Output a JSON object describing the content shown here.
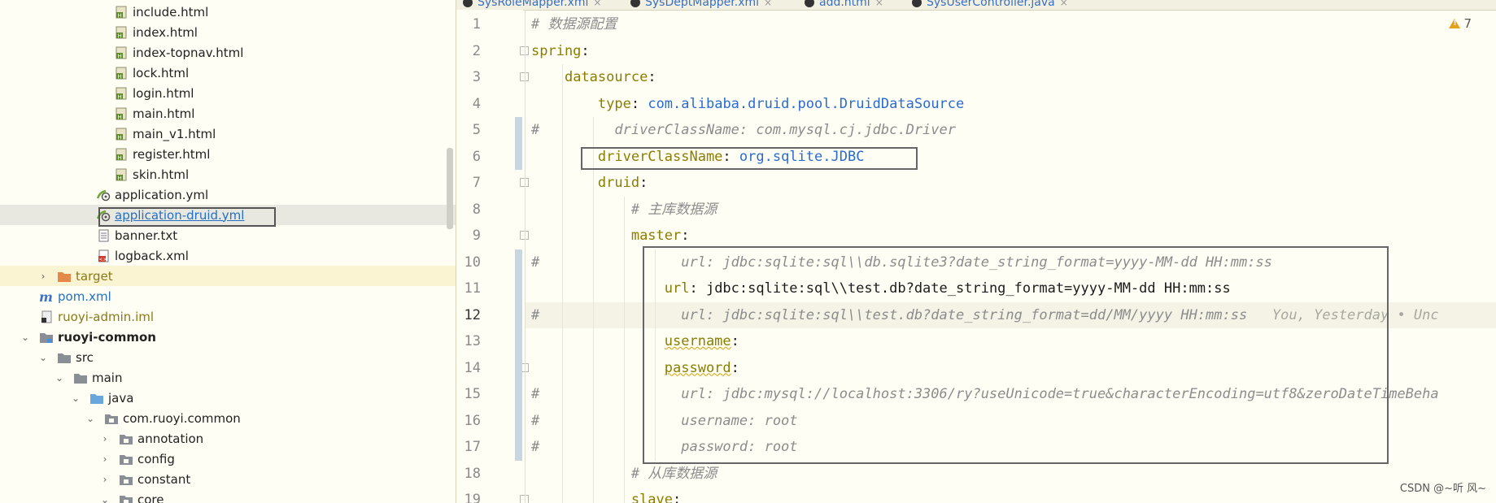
{
  "sidebar": {
    "items": [
      {
        "label": "include.html",
        "type": "html",
        "indent": 3
      },
      {
        "label": "index.html",
        "type": "html",
        "indent": 3
      },
      {
        "label": "index-topnav.html",
        "type": "html",
        "indent": 3
      },
      {
        "label": "lock.html",
        "type": "html",
        "indent": 3
      },
      {
        "label": "login.html",
        "type": "html",
        "indent": 3
      },
      {
        "label": "main.html",
        "type": "html",
        "indent": 3
      },
      {
        "label": "main_v1.html",
        "type": "html",
        "indent": 3
      },
      {
        "label": "register.html",
        "type": "html",
        "indent": 3
      },
      {
        "label": "skin.html",
        "type": "html",
        "indent": 3
      },
      {
        "label": "application.yml",
        "type": "yml",
        "indent": 2
      },
      {
        "label": "application-druid.yml",
        "type": "yml",
        "indent": 2,
        "selected": true
      },
      {
        "label": "banner.txt",
        "type": "txt",
        "indent": 2
      },
      {
        "label": "logback.xml",
        "type": "xml",
        "indent": 2
      },
      {
        "label": "target",
        "type": "folder-orange",
        "indent": 0,
        "arrow": "›",
        "excluded": true
      },
      {
        "label": "pom.xml",
        "type": "maven",
        "indent": 0
      },
      {
        "label": "ruoyi-admin.iml",
        "type": "iml",
        "indent": 0
      },
      {
        "label": "ruoyi-common",
        "type": "module",
        "indent": -1,
        "arrow": "⌄",
        "bold": true
      },
      {
        "label": "src",
        "type": "folder",
        "indent": 0,
        "arrow": "⌄"
      },
      {
        "label": "main",
        "type": "folder",
        "indent": 1,
        "arrow": "⌄"
      },
      {
        "label": "java",
        "type": "folder-blue",
        "indent": 2,
        "arrow": "⌄"
      },
      {
        "label": "com.ruoyi.common",
        "type": "package",
        "indent": 3,
        "arrow": "⌄"
      },
      {
        "label": "annotation",
        "type": "package",
        "indent": 4,
        "arrow": "›"
      },
      {
        "label": "config",
        "type": "package",
        "indent": 4,
        "arrow": "›"
      },
      {
        "label": "constant",
        "type": "package",
        "indent": 4,
        "arrow": "›"
      },
      {
        "label": "core",
        "type": "package",
        "indent": 4,
        "arrow": "⌄"
      }
    ]
  },
  "tabs": [
    {
      "label": "SysRoleMapper.xml"
    },
    {
      "label": "SysDeptMapper.xml"
    },
    {
      "label": "add.html"
    },
    {
      "label": "SysUserController.java"
    }
  ],
  "editor": {
    "warnings": "7",
    "current_line": 12,
    "lines": [
      {
        "n": "1",
        "tokens": [
          [
            "cmt",
            "# 数据源配置"
          ]
        ]
      },
      {
        "n": "2",
        "tokens": [
          [
            "key",
            "spring"
          ],
          [
            "txt",
            ":"
          ]
        ]
      },
      {
        "n": "3",
        "tokens": [
          [
            "txt",
            "    "
          ],
          [
            "key",
            "datasource"
          ],
          [
            "txt",
            ":"
          ]
        ]
      },
      {
        "n": "4",
        "tokens": [
          [
            "txt",
            "        "
          ],
          [
            "key",
            "type"
          ],
          [
            "txt",
            ": "
          ],
          [
            "val",
            "com.alibaba.druid.pool.DruidDataSource"
          ]
        ]
      },
      {
        "n": "5",
        "tokens": [
          [
            "hash",
            "#"
          ],
          [
            "cmt",
            "         driverClassName: com.mysql.cj.jdbc.Driver"
          ]
        ]
      },
      {
        "n": "6",
        "tokens": [
          [
            "txt",
            "        "
          ],
          [
            "key",
            "driverClassName"
          ],
          [
            "txt",
            ": "
          ],
          [
            "val",
            "org.sqlite.JDBC"
          ]
        ]
      },
      {
        "n": "7",
        "tokens": [
          [
            "txt",
            "        "
          ],
          [
            "key",
            "druid"
          ],
          [
            "txt",
            ":"
          ]
        ]
      },
      {
        "n": "8",
        "tokens": [
          [
            "txt",
            "            "
          ],
          [
            "cmt",
            "# 主库数据源"
          ]
        ]
      },
      {
        "n": "9",
        "tokens": [
          [
            "txt",
            "            "
          ],
          [
            "key",
            "master"
          ],
          [
            "txt",
            ":"
          ]
        ]
      },
      {
        "n": "10",
        "tokens": [
          [
            "hash",
            "#"
          ],
          [
            "cmt",
            "                 url: jdbc:sqlite:sql\\\\db.sqlite3?date_string_format=yyyy-MM-dd HH:mm:ss"
          ]
        ]
      },
      {
        "n": "11",
        "tokens": [
          [
            "txt",
            "                "
          ],
          [
            "key",
            "url"
          ],
          [
            "txt",
            ": jdbc:sqlite:sql\\\\test.db?date_string_format=yyyy-MM-dd HH:mm:ss"
          ]
        ]
      },
      {
        "n": "12",
        "tokens": [
          [
            "hash",
            "#"
          ],
          [
            "cmt",
            "                 url: jdbc:sqlite:sql\\\\test.db?date_string_format=dd/MM/yyyy HH:mm:ss"
          ],
          [
            "blame",
            "   You, Yesterday • Unc"
          ]
        ]
      },
      {
        "n": "13",
        "tokens": [
          [
            "txt",
            "                "
          ],
          [
            "key squig",
            "username"
          ],
          [
            "txt",
            ":"
          ]
        ]
      },
      {
        "n": "14",
        "tokens": [
          [
            "txt",
            "                "
          ],
          [
            "key squig",
            "password"
          ],
          [
            "txt",
            ":"
          ]
        ]
      },
      {
        "n": "15",
        "tokens": [
          [
            "hash",
            "#"
          ],
          [
            "cmt",
            "                 url: jdbc:mysql://localhost:3306/ry?useUnicode=true&characterEncoding=utf8&zeroDateTimeBeha"
          ]
        ]
      },
      {
        "n": "16",
        "tokens": [
          [
            "hash",
            "#"
          ],
          [
            "cmt",
            "                 username: root"
          ]
        ]
      },
      {
        "n": "17",
        "tokens": [
          [
            "hash",
            "#"
          ],
          [
            "cmt",
            "                 password: root"
          ]
        ]
      },
      {
        "n": "18",
        "tokens": [
          [
            "txt",
            "            "
          ],
          [
            "cmt",
            "# 从库数据源"
          ]
        ]
      },
      {
        "n": "19",
        "tokens": [
          [
            "txt",
            "            "
          ],
          [
            "key",
            "slave"
          ],
          [
            "txt",
            ":"
          ]
        ]
      }
    ]
  },
  "watermark": "CSDN @~听 风~",
  "colors": {
    "key": "#8a7d00",
    "value": "#2a6bd0",
    "comment": "#8c8c8c",
    "link": "#2470c2",
    "warning": "#e3a21a"
  }
}
